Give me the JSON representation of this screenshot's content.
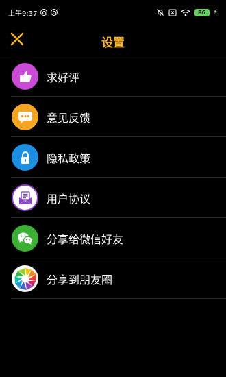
{
  "status_bar": {
    "time": "上午9:37",
    "battery": "86"
  },
  "header": {
    "title": "设置"
  },
  "menu": [
    {
      "label": "求好评",
      "icon": "thumbs-up-icon",
      "color": "#c94bd6"
    },
    {
      "label": "意见反馈",
      "icon": "chat-bubble-icon",
      "color": "#f4a623"
    },
    {
      "label": "隐私政策",
      "icon": "lock-icon",
      "color": "#1d8fe3"
    },
    {
      "label": "用户协议",
      "icon": "document-envelope-icon",
      "color": "#ffffff"
    },
    {
      "label": "分享给微信好友",
      "icon": "wechat-icon",
      "color": "#3cb035"
    },
    {
      "label": "分享到朋友圈",
      "icon": "moments-aperture-icon",
      "color": "#ffffff"
    }
  ],
  "colors": {
    "accent": "#f6b22d",
    "background": "#000000"
  }
}
